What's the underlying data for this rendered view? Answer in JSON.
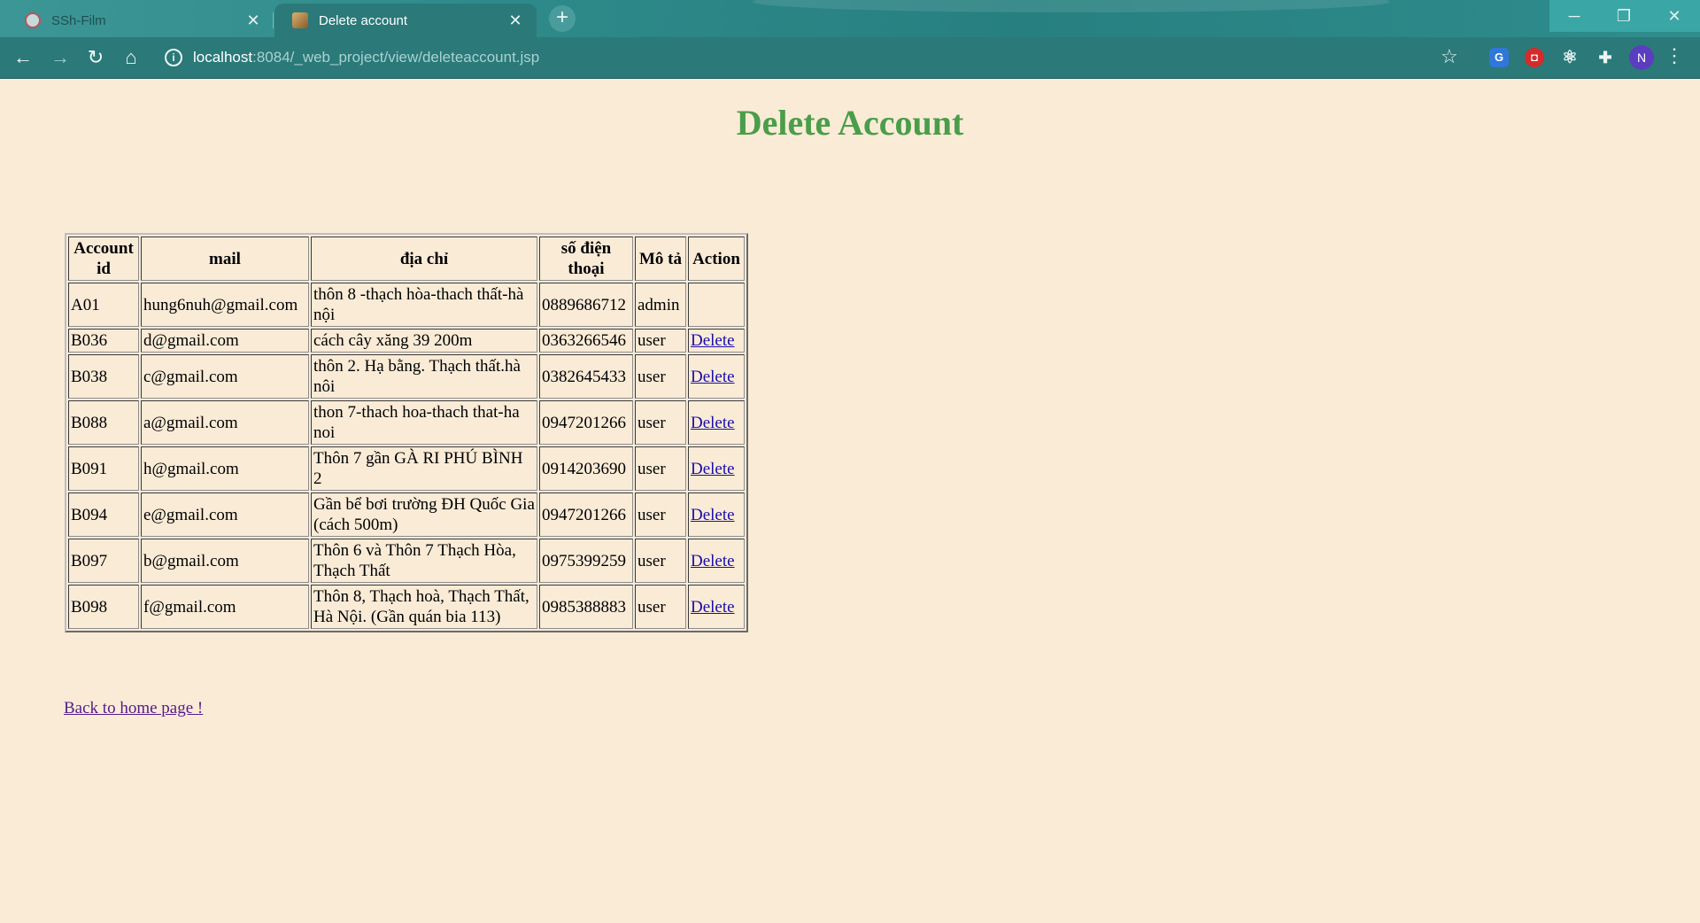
{
  "browser": {
    "tabs": [
      {
        "title": "SSh-Film",
        "active": false
      },
      {
        "title": "Delete account",
        "active": true
      }
    ],
    "url_host": "localhost",
    "url_path": ":8084/_web_project/view/deleteaccount.jsp",
    "profile_initial": "N",
    "icons": [
      "back-icon",
      "forward-icon",
      "reload-icon",
      "home-icon",
      "info-icon",
      "star-icon",
      "translate-icon",
      "adblock-icon",
      "react-devtools-icon",
      "extensions-icon",
      "menu-icon"
    ]
  },
  "page": {
    "title": "Delete Account",
    "columns": [
      "Account id",
      "mail",
      "địa chỉ",
      "số điện thoại",
      "Mô tả",
      "Action"
    ],
    "rows": [
      {
        "id": "A01",
        "mail": "hung6nuh@gmail.com",
        "address": "thôn 8 -thạch hòa-thach thất-hà nội",
        "phone": "0889686712",
        "role": "admin",
        "action": ""
      },
      {
        "id": "B036",
        "mail": "d@gmail.com",
        "address": "cách cây xăng 39 200m",
        "phone": "0363266546",
        "role": "user",
        "action": "Delete"
      },
      {
        "id": "B038",
        "mail": "c@gmail.com",
        "address": "thôn 2. Hạ bằng. Thạch thất.hà nôi",
        "phone": "0382645433",
        "role": "user",
        "action": "Delete"
      },
      {
        "id": "B088",
        "mail": "a@gmail.com",
        "address": "thon 7-thach hoa-thach that-ha noi",
        "phone": "0947201266",
        "role": "user",
        "action": "Delete"
      },
      {
        "id": "B091",
        "mail": "h@gmail.com",
        "address": "Thôn 7 gần GÀ RI PHÚ BÌNH 2",
        "phone": "0914203690",
        "role": "user",
        "action": "Delete"
      },
      {
        "id": "B094",
        "mail": "e@gmail.com",
        "address": "Gần bể bơi trường ĐH Quốc Gia (cách 500m)",
        "phone": "0947201266",
        "role": "user",
        "action": "Delete"
      },
      {
        "id": "B097",
        "mail": "b@gmail.com",
        "address": "Thôn 6 và Thôn 7 Thạch Hòa, Thạch Thất",
        "phone": "0975399259",
        "role": "user",
        "action": "Delete"
      },
      {
        "id": "B098",
        "mail": "f@gmail.com",
        "address": "Thôn 8, Thạch hoà, Thạch Thất, Hà Nội. (Gần quán bia 113)",
        "phone": "0985388883",
        "role": "user",
        "action": "Delete"
      }
    ],
    "back_link": "Back to home page !"
  },
  "colors": {
    "page_background": "#faebd7",
    "title": "#4a9e4a",
    "link": "#1a0dab",
    "chrome": "#2b7979"
  }
}
